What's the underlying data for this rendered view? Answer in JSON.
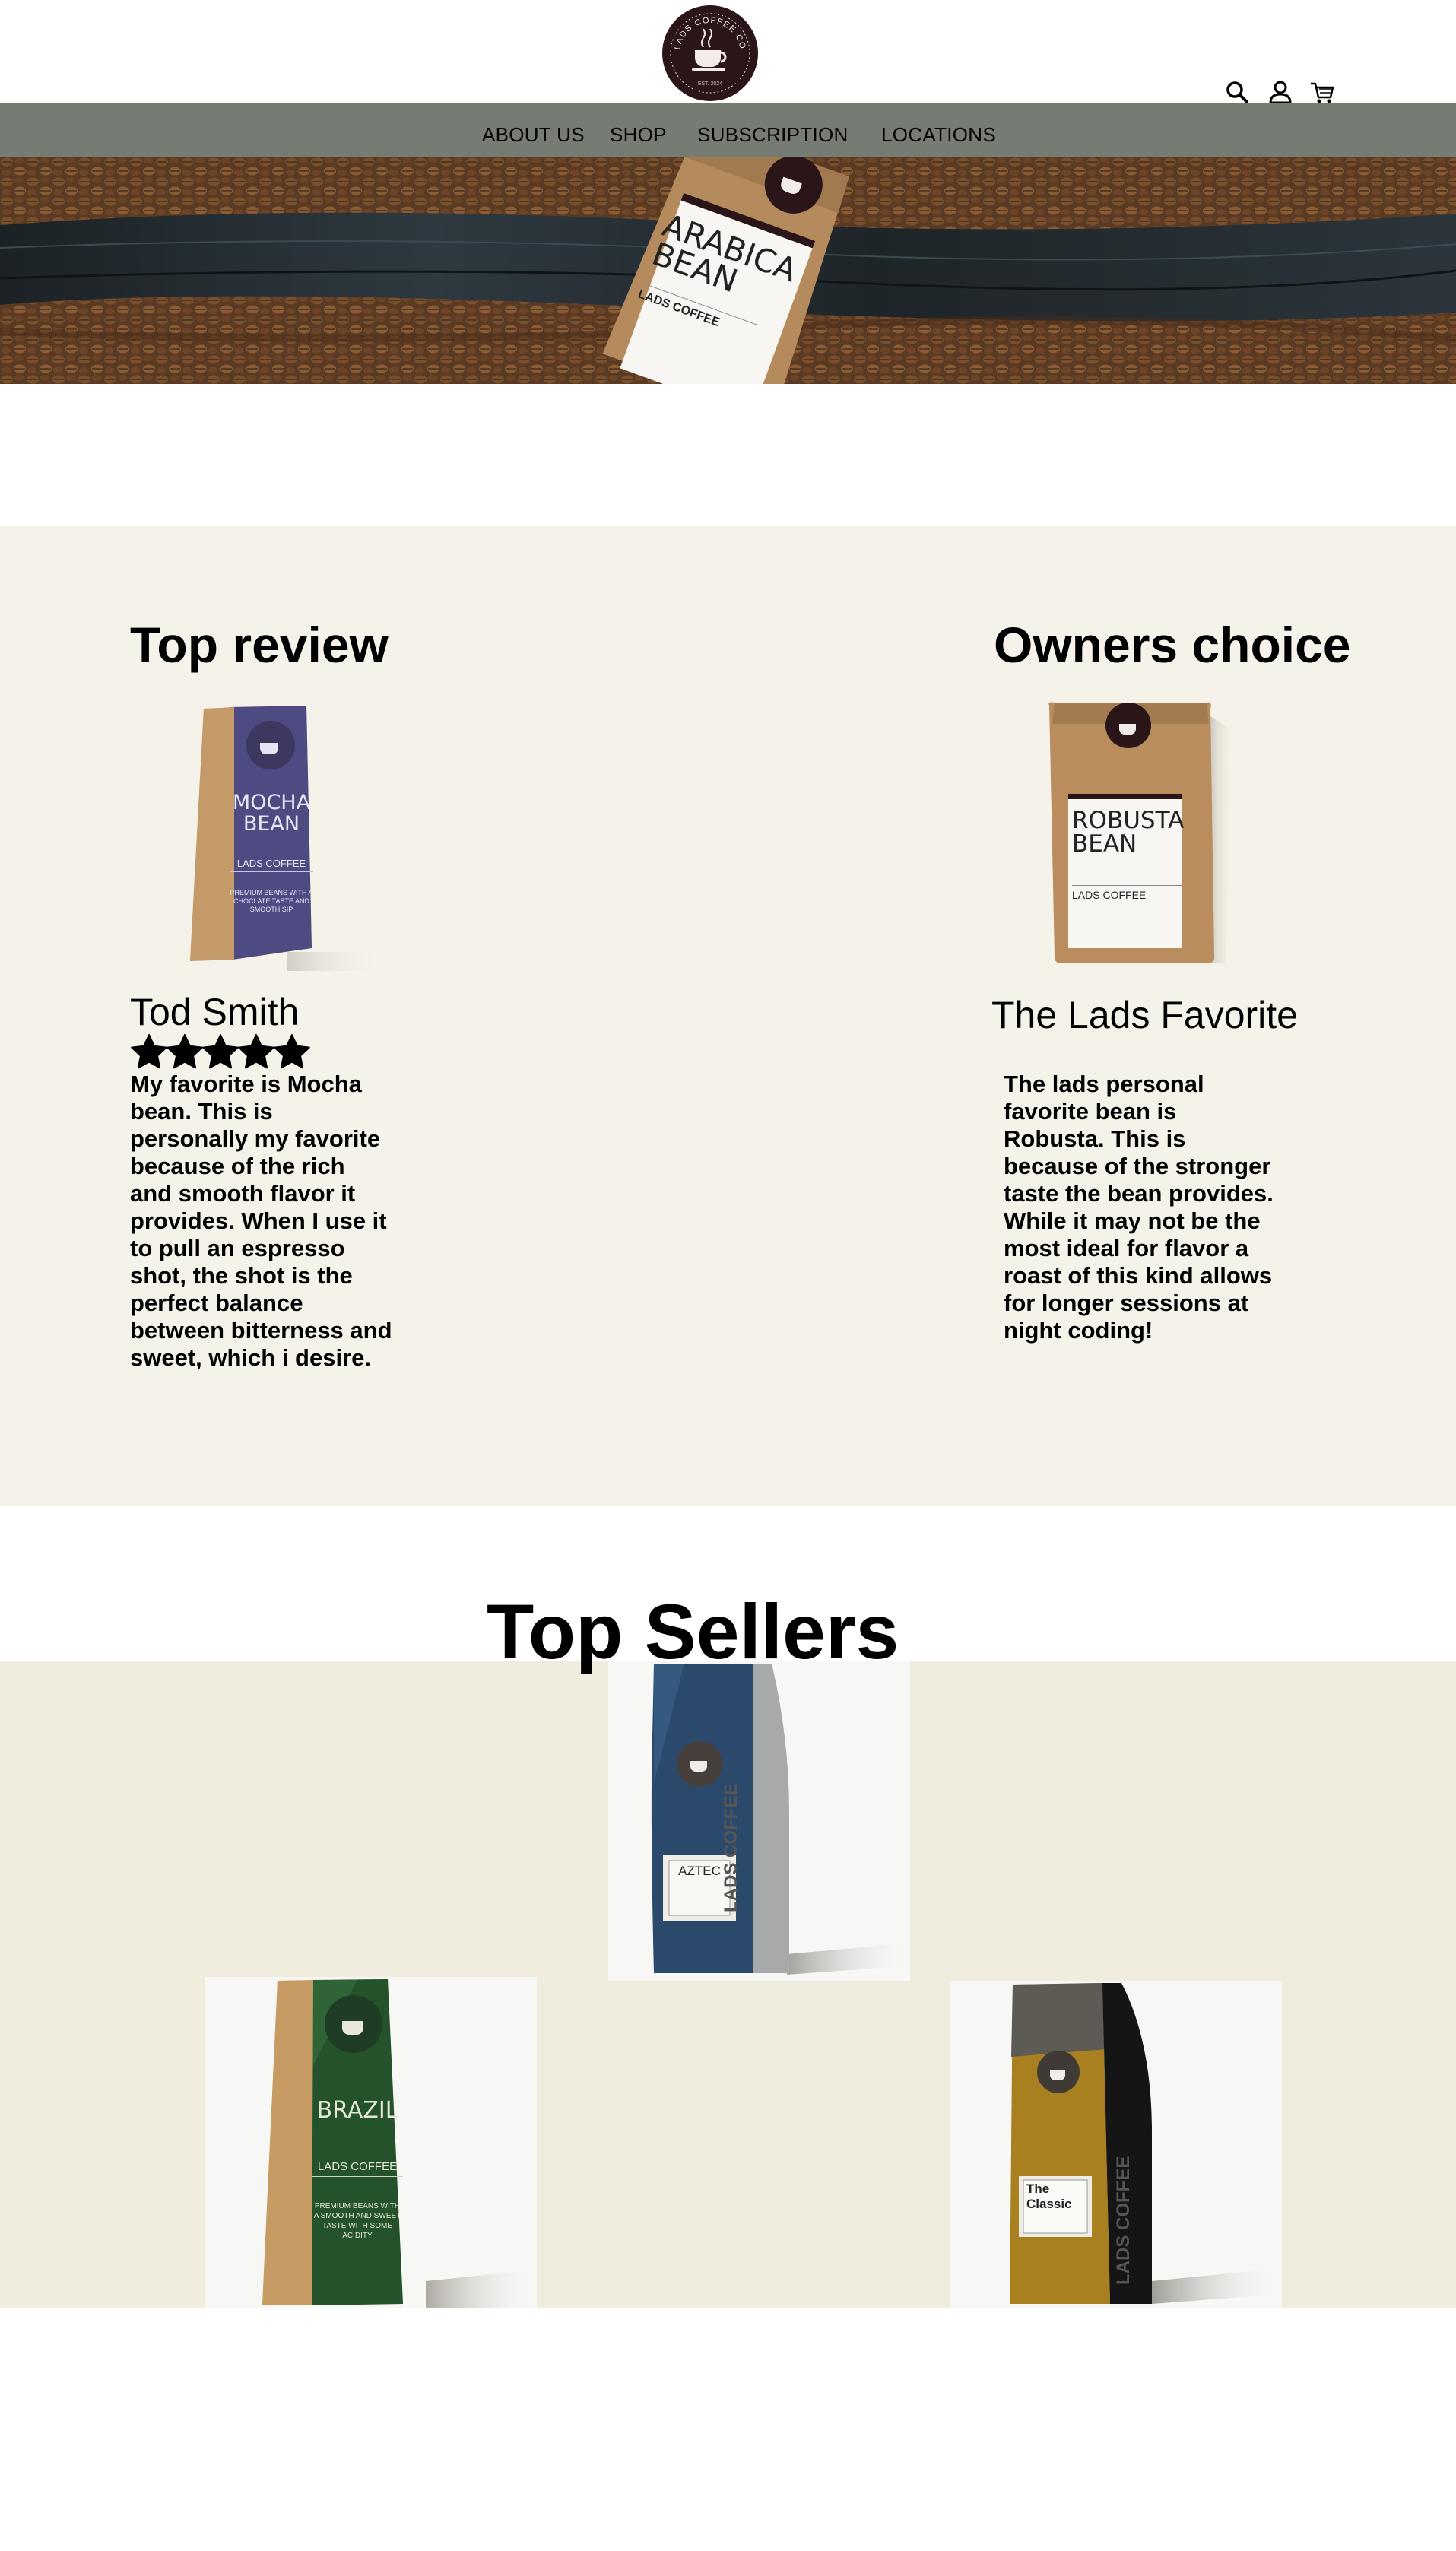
{
  "brand": {
    "logo_text": "LADS COFFEE CO",
    "logo_year": "EST. 2024"
  },
  "header": {
    "icons": [
      "search-icon",
      "account-icon",
      "cart-icon"
    ]
  },
  "nav": {
    "items": [
      {
        "label": "ABOUT US"
      },
      {
        "label": "SHOP"
      },
      {
        "label": "SUBSCRIPTION"
      },
      {
        "label": "LOCATIONS"
      }
    ]
  },
  "hero": {
    "bag_title_line1": "ARABICA",
    "bag_title_line2": "BEAN",
    "bag_brand": "LADS COFFEE"
  },
  "reviews": {
    "top_review": {
      "heading": "Top review",
      "product": {
        "title_line1": "MOCHA",
        "title_line2": "BEAN",
        "brand": "LADS COFFEE",
        "tagline": "PREMIUM BEANS WITH A CHOCLATE TASTE AND SMOOTH SIP"
      },
      "reviewer": "Tod Smith",
      "rating": 5,
      "text": "My favorite is  Mocha bean. This is personally my favorite because of the rich and smooth flavor it provides. When I use it to pull an espresso shot, the shot is the perfect balance between bitterness and sweet, which i desire."
    },
    "owners_choice": {
      "heading": "Owners choice",
      "product": {
        "title_line1": "ROBUSTA",
        "title_line2": "BEAN",
        "brand": "LADS COFFEE"
      },
      "title": "The Lads Favorite",
      "text": "The lads personal favorite bean is Robusta. This is because of the stronger taste the bean provides. While it may not be the most ideal for flavor a roast of this kind allows for longer sessions at night coding!"
    }
  },
  "top_sellers": {
    "heading": "Top Sellers",
    "products": [
      {
        "name": "AZTEC",
        "side_label": "LADS COFFEE"
      },
      {
        "name": "BRAZIL",
        "brand": "LADS COFFEE",
        "tagline": "PREMIUM BEANS WITH A SMOOTH AND SWEET TASTE WITH SOME ACIDITY"
      },
      {
        "name": "The Classic",
        "side_label": "LADS COFFEE"
      }
    ]
  },
  "colors": {
    "nav_bg": "#767b74",
    "reviews_bg": "#f5f2e9",
    "sellers_bg": "#f0ecde",
    "logo_bg": "#2a1518",
    "mocha_bag": "#4e4a82",
    "aztec_bag": "#2b4a6b",
    "brazil_bag": "#23522b",
    "classic_bag": "#a9801f"
  }
}
